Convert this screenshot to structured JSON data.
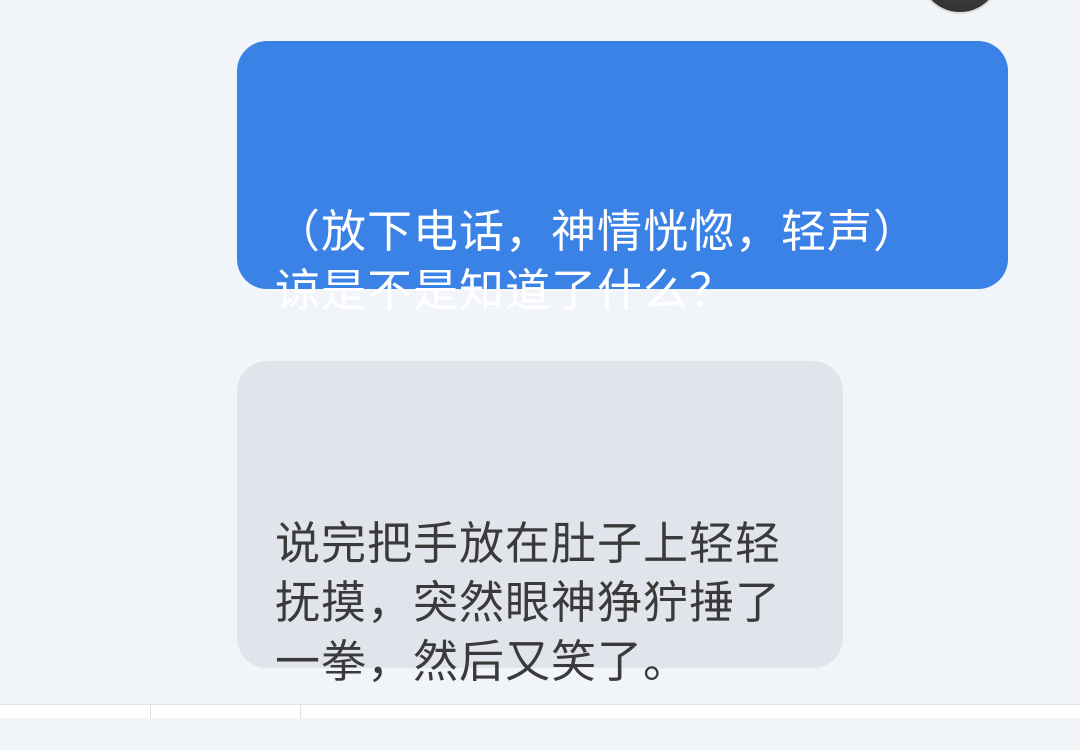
{
  "chat": {
    "messages": [
      {
        "sender": "self",
        "text": "（放下电话，神情恍惚，轻声）谅是不是知道了什么？"
      },
      {
        "sender": "other",
        "text": "说完把手放在肚子上轻轻抚摸，突然眼神狰狞捶了一拳，然后又笑了。"
      }
    ]
  },
  "colors": {
    "background": "#f1f4f9",
    "sent_bubble": "#3b82e6",
    "received_bubble": "#e1e4ea",
    "sent_text": "#ffffff",
    "received_text": "#3a3a3a"
  }
}
